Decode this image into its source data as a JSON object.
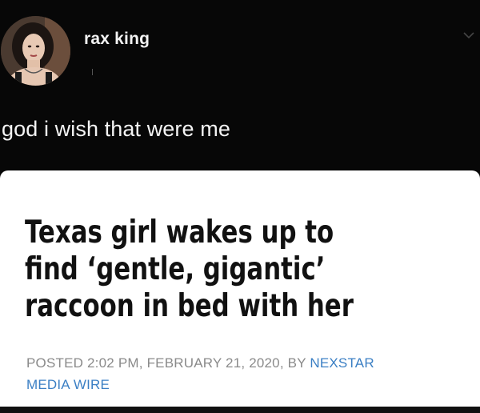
{
  "tweet": {
    "display_name": "rax king",
    "handle": "(",
    "text": "god i wish that were me",
    "avatar_icon": "profile-photo",
    "menu_icon": "chevron-down-icon"
  },
  "article": {
    "headline_lines": [
      "Texas girl wakes up to",
      "find ‘gentle, gigantic’",
      "raccoon in bed with her"
    ],
    "posted_prefix": "POSTED 2:02 PM, FEBRUARY 21, 2020, BY ",
    "author_line1": "NEXSTAR",
    "author_line2": "MEDIA WIRE",
    "byline_color": "#8a8a8a",
    "author_color": "#3b7fc4"
  }
}
